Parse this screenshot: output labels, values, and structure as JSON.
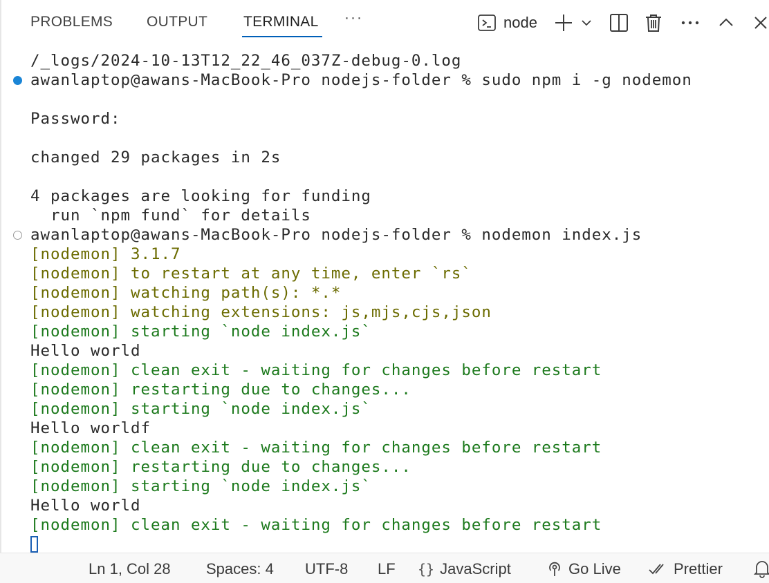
{
  "panel": {
    "tabs": [
      {
        "label": "PROBLEMS",
        "active": false
      },
      {
        "label": "OUTPUT",
        "active": false
      },
      {
        "label": "TERMINAL",
        "active": true
      }
    ],
    "more_tabs_label": "···",
    "terminal_instance_label": "node",
    "accent_color": "#005fb8"
  },
  "terminal": {
    "lines": [
      {
        "text": "/_logs/2024-10-13T12_22_46_037Z-debug-0.log",
        "style": "plain"
      },
      {
        "text": "awanlaptop@awans-MacBook-Pro nodejs-folder % sudo npm i -g nodemon",
        "style": "plain",
        "decoration": "success"
      },
      {
        "text": "",
        "style": "plain"
      },
      {
        "text": "Password:",
        "style": "plain"
      },
      {
        "text": "",
        "style": "plain"
      },
      {
        "text": "changed 29 packages in 2s",
        "style": "plain"
      },
      {
        "text": "",
        "style": "plain"
      },
      {
        "text": "4 packages are looking for funding",
        "style": "plain"
      },
      {
        "text": "  run `npm fund` for details",
        "style": "plain"
      },
      {
        "text": "awanlaptop@awans-MacBook-Pro nodejs-folder % nodemon index.js",
        "style": "plain",
        "decoration": "pending"
      },
      {
        "text": "[nodemon] 3.1.7",
        "style": "nodemon-yellow"
      },
      {
        "text": "[nodemon] to restart at any time, enter `rs`",
        "style": "nodemon-yellow"
      },
      {
        "text": "[nodemon] watching path(s): *.*",
        "style": "nodemon-yellow"
      },
      {
        "text": "[nodemon] watching extensions: js,mjs,cjs,json",
        "style": "nodemon-yellow"
      },
      {
        "text": "[nodemon] starting `node index.js`",
        "style": "nodemon-green"
      },
      {
        "text": "Hello world",
        "style": "plain"
      },
      {
        "text": "[nodemon] clean exit - waiting for changes before restart",
        "style": "nodemon-green"
      },
      {
        "text": "[nodemon] restarting due to changes...",
        "style": "nodemon-green"
      },
      {
        "text": "[nodemon] starting `node index.js`",
        "style": "nodemon-green"
      },
      {
        "text": "Hello worldf",
        "style": "plain"
      },
      {
        "text": "[nodemon] clean exit - waiting for changes before restart",
        "style": "nodemon-green"
      },
      {
        "text": "[nodemon] restarting due to changes...",
        "style": "nodemon-green"
      },
      {
        "text": "[nodemon] starting `node index.js`",
        "style": "nodemon-green"
      },
      {
        "text": "Hello world",
        "style": "plain"
      },
      {
        "text": "[nodemon] clean exit - waiting for changes before restart",
        "style": "nodemon-green"
      }
    ],
    "colors": {
      "nodemon_yellow": "#6b6b00",
      "nodemon_green": "#1d7a1d",
      "decoration_success": "#1a85d6"
    }
  },
  "status_bar": {
    "cursor_position": "Ln 1, Col 28",
    "indentation": "Spaces: 4",
    "encoding": "UTF-8",
    "eol": "LF",
    "language_icon": "{}",
    "language": "JavaScript",
    "go_live": "Go Live",
    "prettier": "Prettier"
  }
}
